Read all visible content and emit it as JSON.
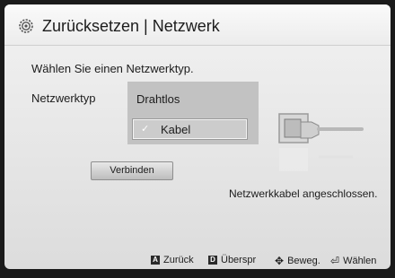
{
  "header": {
    "title": "Zurücksetzen | Netzwerk",
    "icon": "gear-icon"
  },
  "main": {
    "instruction": "Wählen Sie einen Netzwerktyp.",
    "network_type_label": "Netzwerktyp",
    "options": {
      "wireless": "Drahtlos",
      "cable": "Kabel"
    },
    "selected_option": "Kabel",
    "connect_button": "Verbinden",
    "status": "Netzwerkkabel angeschlossen."
  },
  "footer": {
    "back": {
      "key": "A",
      "label": "Zurück"
    },
    "skip": {
      "key": "D",
      "label": "Überspr"
    },
    "move": {
      "icon": "arrows-icon",
      "label": "Beweg."
    },
    "select": {
      "icon": "enter-icon",
      "label": "Wählen"
    }
  }
}
